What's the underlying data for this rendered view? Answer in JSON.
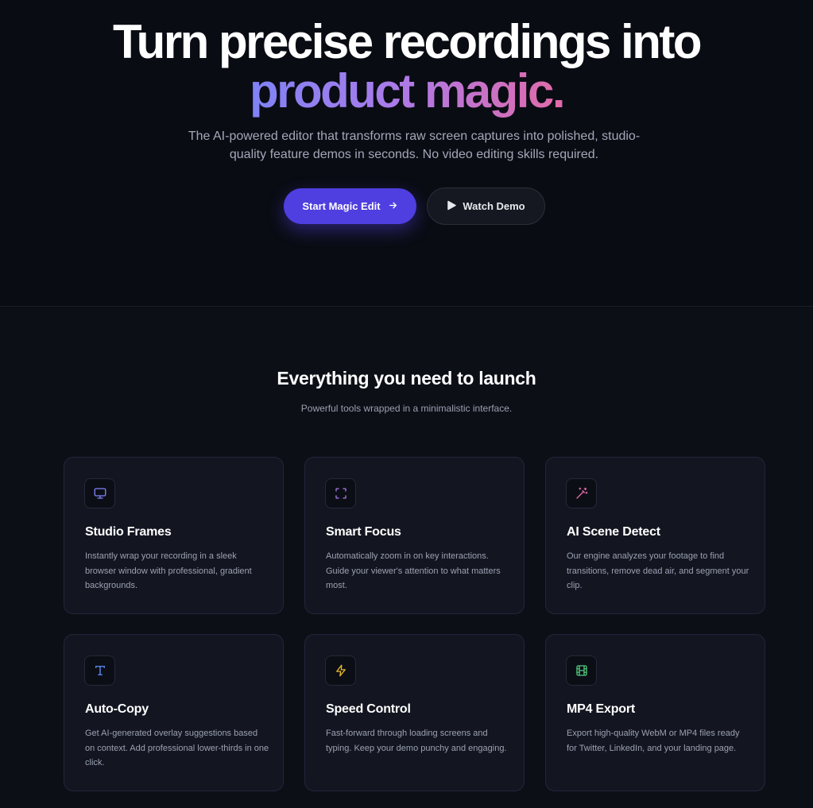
{
  "hero": {
    "title_line1": "Turn precise recordings into",
    "title_line2": "product magic.",
    "subtitle": "The AI-powered editor that transforms raw screen captures into polished, studio-quality feature demos in seconds. No video editing skills required.",
    "primary_button": "Start Magic Edit",
    "secondary_button": "Watch Demo"
  },
  "features": {
    "title": "Everything you need to launch",
    "subtitle": "Powerful tools wrapped in a minimalistic interface.",
    "cards": [
      {
        "icon": "monitor-icon",
        "icon_color": "#7f83f6",
        "title": "Studio Frames",
        "desc": "Instantly wrap your recording in a sleek browser window with professional, gradient backgrounds."
      },
      {
        "icon": "focus-icon",
        "icon_color": "#a97bea",
        "title": "Smart Focus",
        "desc": "Automatically zoom in on key interactions. Guide your viewer's attention to what matters most."
      },
      {
        "icon": "magic-wand-icon",
        "icon_color": "#e26aa8",
        "title": "AI Scene Detect",
        "desc": "Our engine analyzes your footage to find transitions, remove dead air, and segment your clip."
      },
      {
        "icon": "text-icon",
        "icon_color": "#5f8ff5",
        "title": "Auto-Copy",
        "desc": "Get AI-generated overlay suggestions based on context. Add professional lower-thirds in one click."
      },
      {
        "icon": "lightning-icon",
        "icon_color": "#e7b92e",
        "title": "Speed Control",
        "desc": "Fast-forward through loading screens and typing. Keep your demo punchy and engaging."
      },
      {
        "icon": "film-icon",
        "icon_color": "#4fc779",
        "title": "MP4 Export",
        "desc": "Export high-quality WebM or MP4 files ready for Twitter, LinkedIn, and your landing page."
      }
    ]
  }
}
